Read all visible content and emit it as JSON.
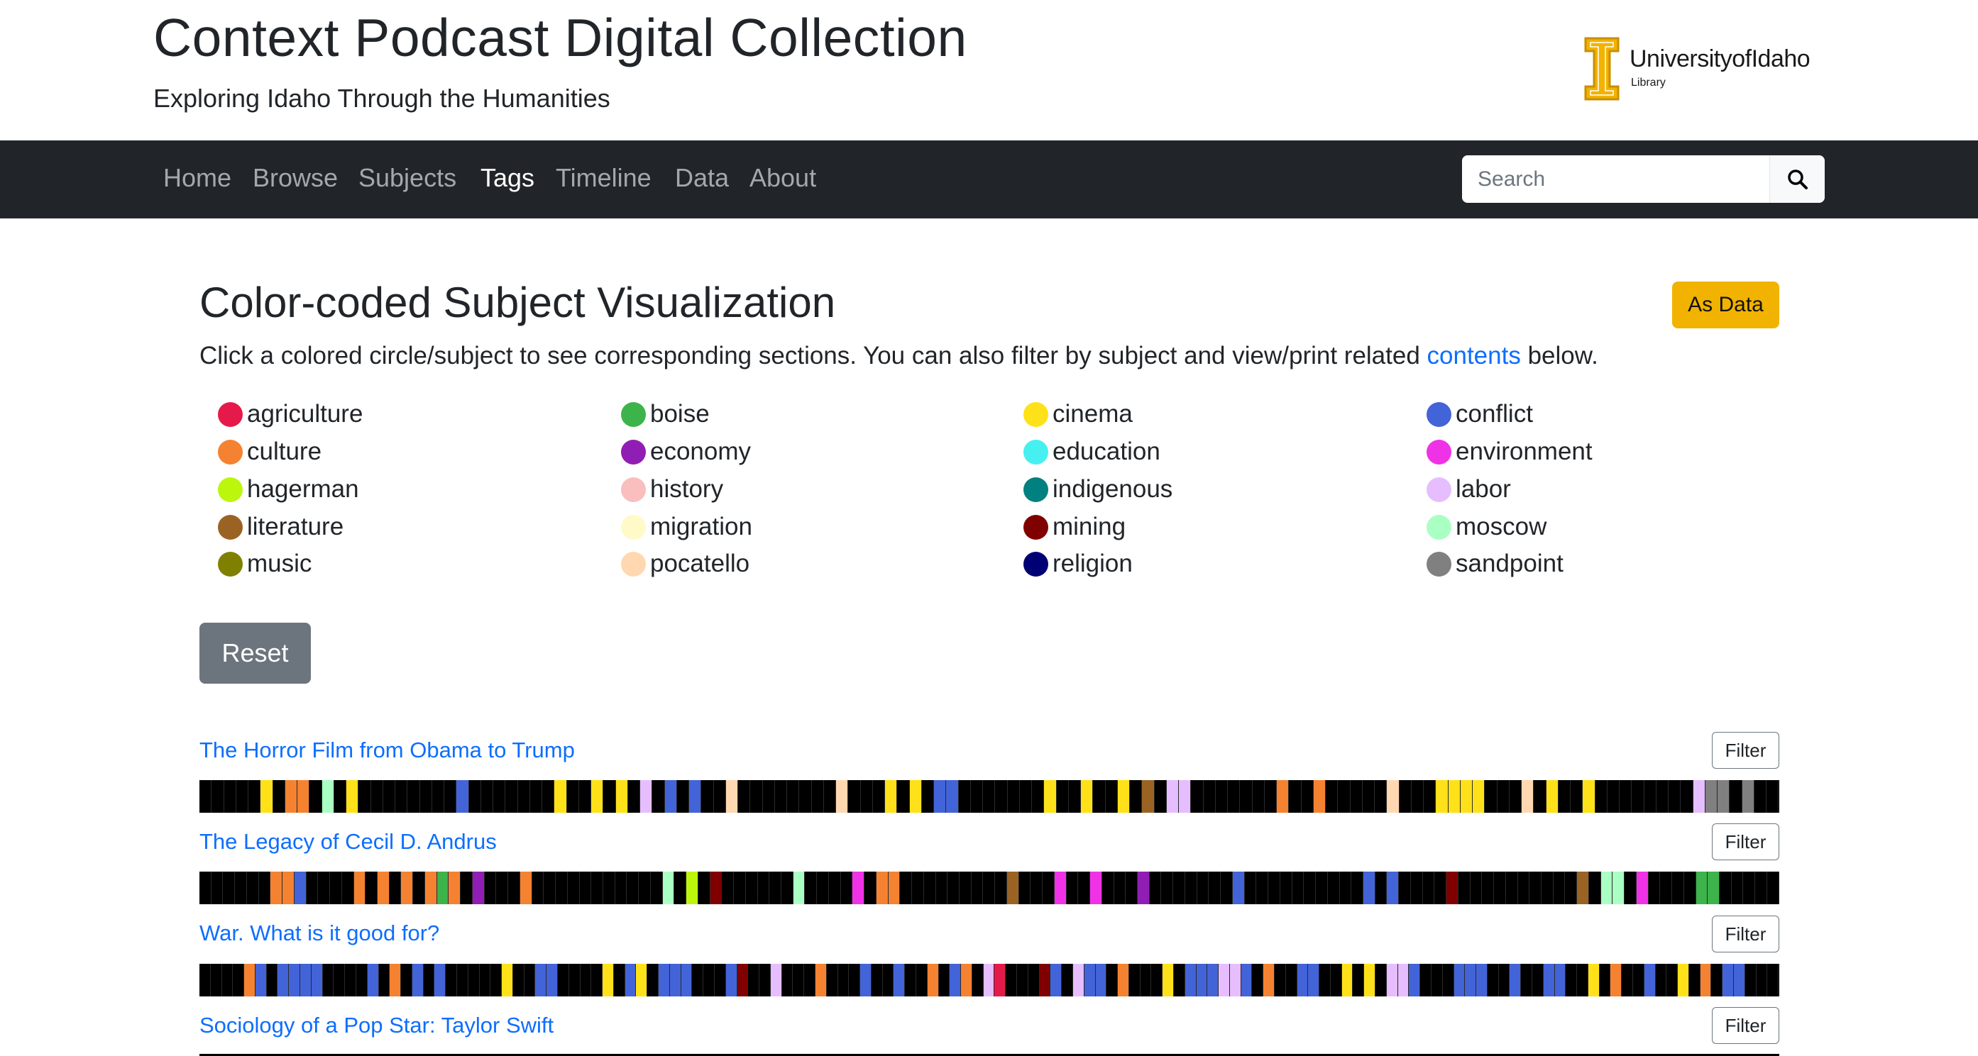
{
  "header": {
    "title": "Context Podcast Digital Collection",
    "subtitle": "Exploring Idaho Through the Humanities",
    "logo": {
      "text": "UniversityofIdaho",
      "sub": "Library"
    }
  },
  "nav": {
    "items": [
      {
        "label": "Home"
      },
      {
        "label": "Browse"
      },
      {
        "label": "Subjects"
      },
      {
        "label": "Tags",
        "active": true
      },
      {
        "label": "Timeline"
      },
      {
        "label": "Data"
      },
      {
        "label": "About"
      }
    ],
    "search_placeholder": "Search"
  },
  "main": {
    "title": "Color-coded Subject Visualization",
    "as_data_label": "As Data",
    "intro_before": "Click a colored circle/subject to see corresponding sections. You can also filter by subject and view/print related ",
    "intro_link": "contents",
    "intro_after": " below.",
    "reset_label": "Reset",
    "filter_label": "Filter"
  },
  "subjects": [
    {
      "name": "agriculture",
      "color": "#e6194b"
    },
    {
      "name": "boise",
      "color": "#3cb44b"
    },
    {
      "name": "cinema",
      "color": "#ffe119"
    },
    {
      "name": "conflict",
      "color": "#4363d8"
    },
    {
      "name": "culture",
      "color": "#f58231"
    },
    {
      "name": "economy",
      "color": "#911eb4"
    },
    {
      "name": "education",
      "color": "#46f0f0"
    },
    {
      "name": "environment",
      "color": "#f032e6"
    },
    {
      "name": "hagerman",
      "color": "#bcf60c"
    },
    {
      "name": "history",
      "color": "#fabebe"
    },
    {
      "name": "indigenous",
      "color": "#008080"
    },
    {
      "name": "labor",
      "color": "#e6beff"
    },
    {
      "name": "literature",
      "color": "#9a6324"
    },
    {
      "name": "migration",
      "color": "#fffac8"
    },
    {
      "name": "mining",
      "color": "#800000"
    },
    {
      "name": "moscow",
      "color": "#aaffc3"
    },
    {
      "name": "music",
      "color": "#808000"
    },
    {
      "name": "pocatello",
      "color": "#ffd8b1"
    },
    {
      "name": "religion",
      "color": "#000075"
    },
    {
      "name": "sandpoint",
      "color": "#808080"
    }
  ],
  "episodes": [
    {
      "title": "The Horror Film from Obama to Trump",
      "segments": "-----c-ee-p-c--------d-------c--c-c-l-d-d--r--------r---c-c-dd-------c--c--c-m-ll-------e--e-----r---cccc---r-c--c--------ltt-t--"
    },
    {
      "title": "The Legacy of Cecil D. Andrus",
      "segments": "------eed----eye-e-ebe-f---e-----------p-i-o------p----h-ee---------m---h--h---f-------d----------d-d--y-o----------m-pp-h----bb-----"
    },
    {
      "title": "War. What is it good for?",
      "segments": "----ed-dddd----d-e-d-d-----c--dd----c-dc-ddd---do--l---e---d--d--e-de-la---od-ldd-e---c-dddlld-e--dd--c-c-lld---ddd--d--dd--c-e--d--c-e-dd---"
    },
    {
      "title": "Sociology of a Pop Star: Taylor Swift"
    }
  ]
}
